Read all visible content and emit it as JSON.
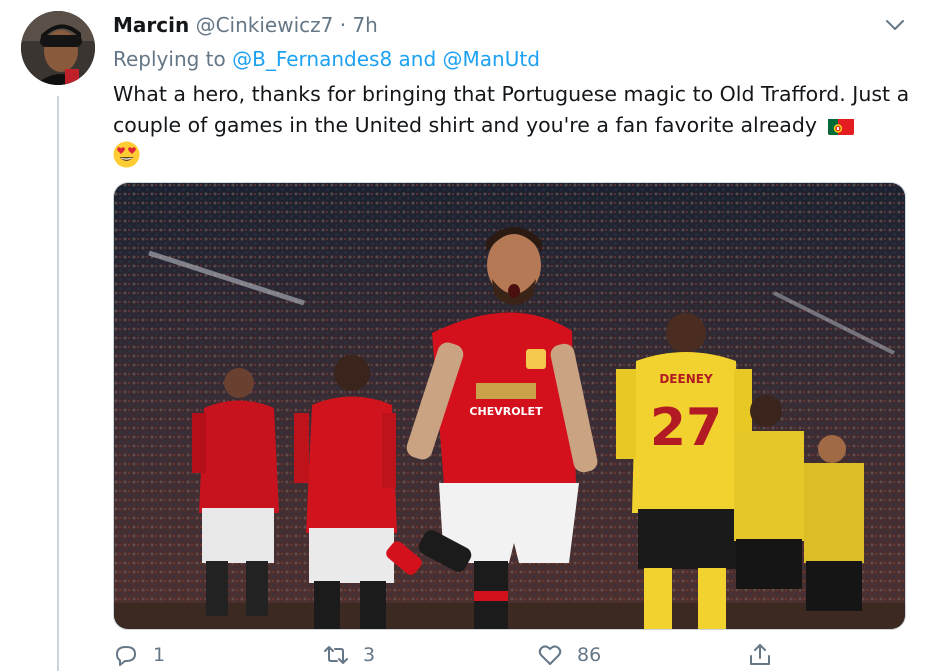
{
  "tweet": {
    "author_name": "Marcin",
    "author_handle": "@Cinkiewicz7",
    "separator": "·",
    "time": "7h",
    "replying_prefix": "Replying to",
    "reply_handles": "@B_Fernandes8 and @ManUtd",
    "text": "What a hero, thanks for bringing that Portuguese magic to Old Trafford. Just a couple of games in the United shirt and you're a fan favorite already",
    "image_sponsor": "CHEVROLET",
    "image_shirt_number": "27",
    "image_opponent_name": "DEENEY"
  },
  "actions": {
    "reply_count": "1",
    "retweet_count": "3",
    "like_count": "86"
  },
  "colors": {
    "link": "#1da1f2",
    "secondary_text": "#657786",
    "united_red": "#d4101c",
    "watford_yellow": "#f2d22e"
  },
  "icons": [
    "chevron-down-icon",
    "reply-icon",
    "retweet-icon",
    "like-icon",
    "share-icon",
    "portugal-flag-icon",
    "heart-eyes-emoji-icon"
  ]
}
